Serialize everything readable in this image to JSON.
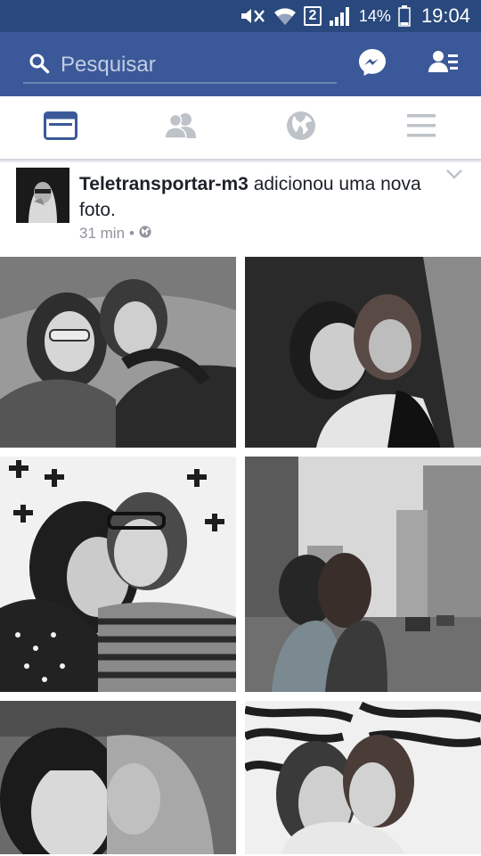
{
  "status_bar": {
    "sim_slot": "2",
    "battery": "14%",
    "time": "19:04",
    "icons": [
      "mute-icon",
      "wifi-icon",
      "sim-icon",
      "signal-icon",
      "battery-icon"
    ]
  },
  "header": {
    "search_placeholder": "Pesquisar",
    "icons": [
      "search-icon",
      "messenger-icon",
      "friend-requests-icon"
    ],
    "colors": {
      "bar": "#3b5998",
      "status": "#29487d"
    }
  },
  "tabs": [
    {
      "name": "news-feed",
      "icon": "news-feed-icon",
      "active": true
    },
    {
      "name": "friends",
      "icon": "friends-icon",
      "active": false
    },
    {
      "name": "notifications",
      "icon": "globe-icon",
      "active": false
    },
    {
      "name": "menu",
      "icon": "menu-icon",
      "active": false
    }
  ],
  "post": {
    "author": "Teletransportar-m3",
    "action": "adicionou uma nova foto.",
    "time": "31 min",
    "separator": "•",
    "privacy_icon": "globe-icon",
    "photos": 6
  }
}
